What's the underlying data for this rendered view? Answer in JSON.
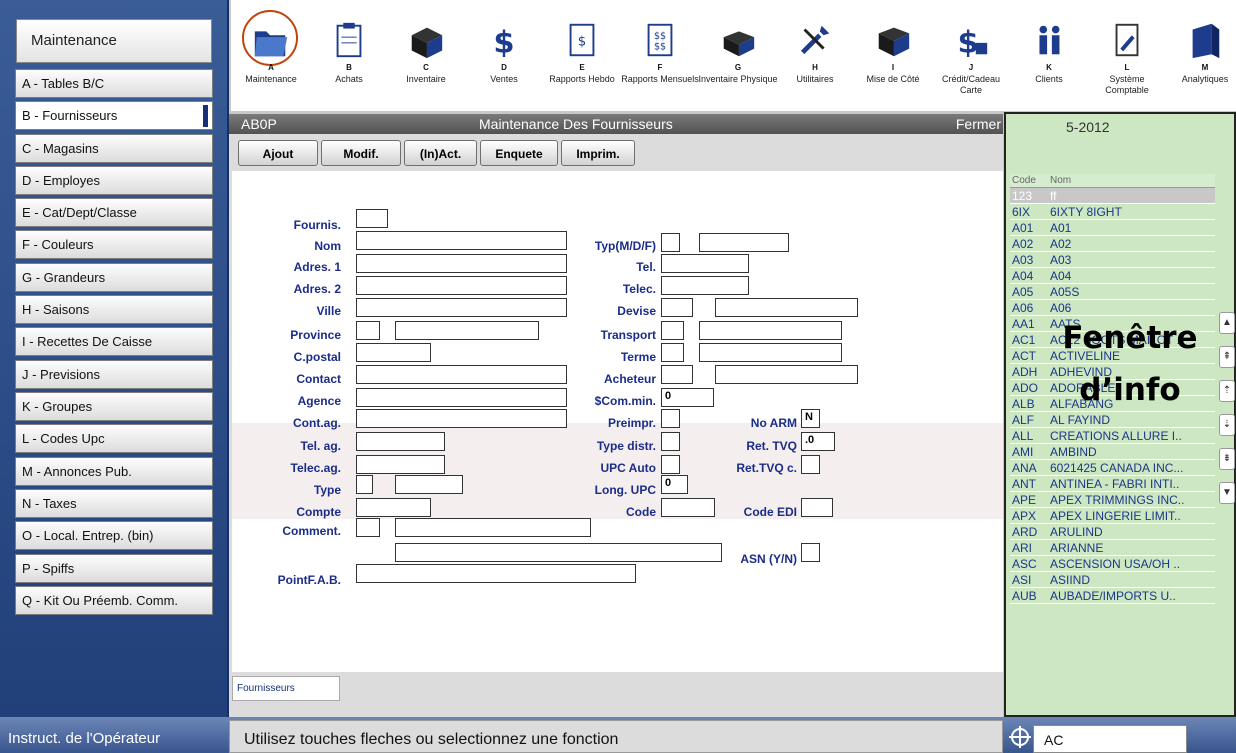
{
  "sidebar": {
    "title": "Maintenance",
    "items": [
      {
        "label": "A - Tables B/C"
      },
      {
        "label": "B - Fournisseurs"
      },
      {
        "label": "C - Magasins"
      },
      {
        "label": "D - Employes"
      },
      {
        "label": "E - Cat/Dept/Classe"
      },
      {
        "label": "F - Couleurs"
      },
      {
        "label": "G - Grandeurs"
      },
      {
        "label": "H - Saisons"
      },
      {
        "label": "I - Recettes De Caisse"
      },
      {
        "label": "J - Previsions"
      },
      {
        "label": "K - Groupes"
      },
      {
        "label": "L - Codes Upc"
      },
      {
        "label": "M - Annonces Pub."
      },
      {
        "label": "N - Taxes"
      },
      {
        "label": "O - Local. Entrep. (bin)"
      },
      {
        "label": "P - Spiffs"
      },
      {
        "label": "Q - Kit Ou Préemb. Comm."
      }
    ]
  },
  "toolbar": {
    "items": [
      {
        "letter": "A",
        "label": "Maintenance",
        "icon": "folder-icon"
      },
      {
        "letter": "B",
        "label": "Achats",
        "icon": "clipboard-icon"
      },
      {
        "letter": "C",
        "label": "Inventaire",
        "icon": "box-icon"
      },
      {
        "letter": "D",
        "label": "Ventes",
        "icon": "dollar-icon"
      },
      {
        "letter": "E",
        "label": "Rapports Hebdo",
        "icon": "weekly-report-icon"
      },
      {
        "letter": "F",
        "label": "Rapports Mensuels",
        "icon": "monthly-report-icon"
      },
      {
        "letter": "G",
        "label": "Inventaire Physique",
        "icon": "cube-icon"
      },
      {
        "letter": "H",
        "label": "Utilitaires",
        "icon": "tools-icon"
      },
      {
        "letter": "I",
        "label": "Mise de Côté",
        "icon": "open-box-icon"
      },
      {
        "letter": "J",
        "label": "Crédit/Cadeau Carte",
        "icon": "credit-icon"
      },
      {
        "letter": "K",
        "label": "Clients",
        "icon": "clients-icon"
      },
      {
        "letter": "L",
        "label": "Système Comptable",
        "icon": "accounting-icon"
      },
      {
        "letter": "M",
        "label": "Analytiques",
        "icon": "analytics-icon"
      }
    ]
  },
  "form": {
    "code": "AB0P",
    "title": "Maintenance Des Fournisseurs",
    "close": "Fermer",
    "buttons": [
      "Ajout",
      "Modif.",
      "(In)Act.",
      "Enquete",
      "Imprim."
    ],
    "labels": {
      "fournis": "Fournis.",
      "nom": "Nom",
      "adres1": "Adres. 1",
      "adres2": "Adres. 2",
      "ville": "Ville",
      "province": "Province",
      "cpostal": "C.postal",
      "contact": "Contact",
      "agence": "Agence",
      "contag": "Cont.ag.",
      "telag": "Tel. ag.",
      "telecag": "Telec.ag.",
      "type": "Type",
      "compte": "Compte",
      "comment": "Comment.",
      "pointfab": "PointF.A.B.",
      "typ": "Typ(M/D/F)",
      "tel": "Tel.",
      "telec": "Telec.",
      "devise": "Devise",
      "transport": "Transport",
      "terme": "Terme",
      "acheteur": "Acheteur",
      "scommin": "$Com.min.",
      "preimpr": "Preimpr.",
      "typedistr": "Type distr.",
      "upcauto": "UPC Auto",
      "longupc": "Long. UPC",
      "code": "Code",
      "noarm": "No ARM",
      "rettvq": "Ret. TVQ",
      "rettvqc": "Ret.TVQ c.",
      "codeedi": "Code EDI",
      "asn": "ASN (Y/N)"
    },
    "values": {
      "scommin": "0",
      "noarm": "N",
      "rettvq": ".0",
      "longupc": "0"
    },
    "tab": "Fournisseurs"
  },
  "info": {
    "period": "5-2012",
    "col_code": "Code",
    "col_name": "Nom",
    "overlay_line1": "Fenêtre",
    "overlay_line2": "d’info",
    "rows": [
      {
        "code": "123",
        "name": "ff",
        "selected": true
      },
      {
        "code": "6IX",
        "name": "6IXTY 8IGHT"
      },
      {
        "code": "A01",
        "name": "A01"
      },
      {
        "code": "A02",
        "name": "A02"
      },
      {
        "code": "A03",
        "name": "A03"
      },
      {
        "code": "A04",
        "name": "A04"
      },
      {
        "code": "A05",
        "name": "A05S"
      },
      {
        "code": "A06",
        "name": "A06"
      },
      {
        "code": "AA1",
        "name": "AATS"
      },
      {
        "code": "AC1",
        "name": "AC12 BOOTS MAILOT .."
      },
      {
        "code": "ACT",
        "name": "ACTIVELINE"
      },
      {
        "code": "ADH",
        "name": "ADHEVIND"
      },
      {
        "code": "ADO",
        "name": "ADORABLE"
      },
      {
        "code": "ALB",
        "name": "ALFABANG"
      },
      {
        "code": "ALF",
        "name": "AL FAYIND"
      },
      {
        "code": "ALL",
        "name": "CREATIONS ALLURE I.."
      },
      {
        "code": "AMI",
        "name": "AMBIND"
      },
      {
        "code": "ANA",
        "name": "6021425 CANADA INC..."
      },
      {
        "code": "ANT",
        "name": "ANTINEA - FABRI INTI.."
      },
      {
        "code": "APE",
        "name": "APEX TRIMMINGS INC.."
      },
      {
        "code": "APX",
        "name": "APEX LINGERIE LIMIT.."
      },
      {
        "code": "ARD",
        "name": "ARULIND"
      },
      {
        "code": "ARI",
        "name": "ARIANNE"
      },
      {
        "code": "ASC",
        "name": "ASCENSION USA/OH .."
      },
      {
        "code": "ASI",
        "name": "ASIIND"
      },
      {
        "code": "AUB",
        "name": "AUBADE/IMPORTS U.."
      }
    ]
  },
  "status": {
    "label": "Instruct. de l'Opérateur",
    "message": "Utilisez touches fleches ou selectionnez une fonction",
    "code": "AC"
  }
}
